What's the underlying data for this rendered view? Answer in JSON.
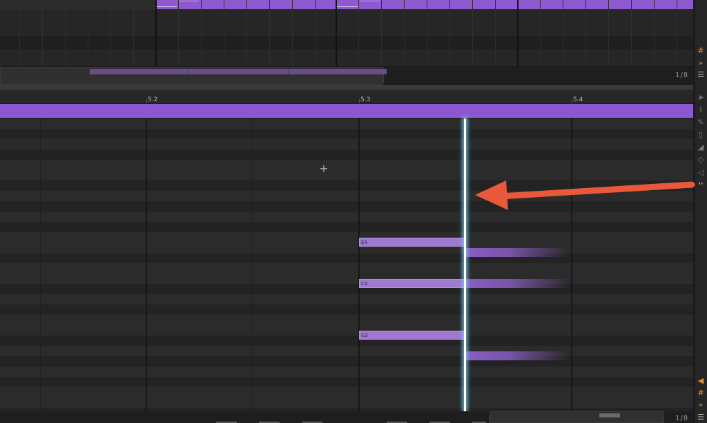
{
  "arrangement": {
    "zoom_label": "1/8"
  },
  "piano_roll": {
    "ruler_labels": [
      "5.2",
      "5.3",
      "5.4"
    ],
    "zoom_label": "1/8",
    "notes": [
      {
        "pitch": "E4"
      },
      {
        "pitch": "C4"
      },
      {
        "pitch": "G3"
      }
    ]
  },
  "tools": [
    "pointer-tool-icon",
    "time-select-tool-icon",
    "pen-tool-icon",
    "eraser-tool-icon",
    "knife-tool-icon",
    "slide-tool-icon",
    "audition-tool-icon",
    "footsteps-tool-icon"
  ],
  "colors": {
    "clip_purple": "#8d57d1",
    "note_purple": "#9f78cf",
    "playhead_glow": "#78d2ff",
    "accent_orange": "#f08a24",
    "annotation_arrow": "#e8583a"
  }
}
